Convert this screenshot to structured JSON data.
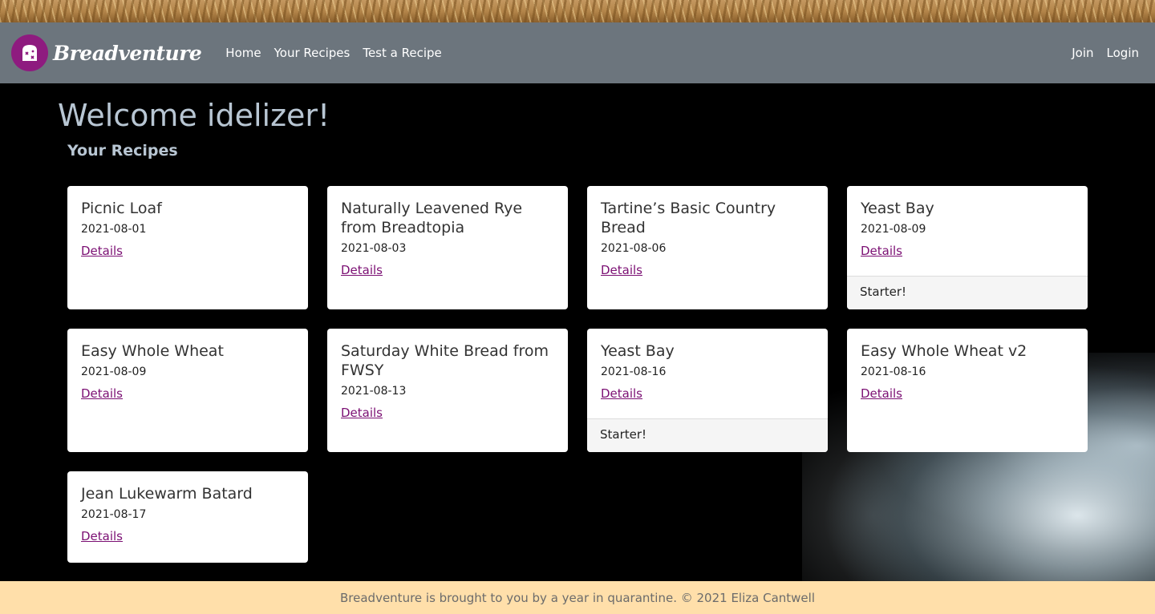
{
  "navbar": {
    "brand": "Breadventure",
    "links": [
      "Home",
      "Your Recipes",
      "Test a Recipe"
    ],
    "right_links": [
      "Join",
      "Login"
    ]
  },
  "main": {
    "welcome": "Welcome idelizer!",
    "subtitle": "Your Recipes",
    "cards": [
      {
        "title": "Picnic Loaf",
        "date": "2021-08-01",
        "link": "Details",
        "footer": ""
      },
      {
        "title": "Naturally Leavened Rye from Breadtopia",
        "date": "2021-08-03",
        "link": "Details",
        "footer": ""
      },
      {
        "title": "Tartine’s Basic Country Bread",
        "date": "2021-08-06",
        "link": "Details",
        "footer": ""
      },
      {
        "title": "Yeast Bay",
        "date": "2021-08-09",
        "link": "Details",
        "footer": "Starter!"
      },
      {
        "title": "Easy Whole Wheat",
        "date": "2021-08-09",
        "link": "Details",
        "footer": ""
      },
      {
        "title": "Saturday White Bread from FWSY",
        "date": "2021-08-13",
        "link": "Details",
        "footer": ""
      },
      {
        "title": "Yeast Bay",
        "date": "2021-08-16",
        "link": "Details",
        "footer": "Starter!"
      },
      {
        "title": "Easy Whole Wheat v2",
        "date": "2021-08-16",
        "link": "Details",
        "footer": ""
      },
      {
        "title": "Jean Lukewarm Batard",
        "date": "2021-08-17",
        "link": "Details",
        "footer": ""
      }
    ]
  },
  "footer": {
    "text": "Breadventure is brought to you by a year in quarantine. © 2021 Eliza Cantwell"
  },
  "colors": {
    "navbar": "#6c757d",
    "logo": "#8e1b7f",
    "link": "#7b0f73",
    "footer_bg": "#ffdfaa",
    "heading": "#b8c6d3"
  }
}
